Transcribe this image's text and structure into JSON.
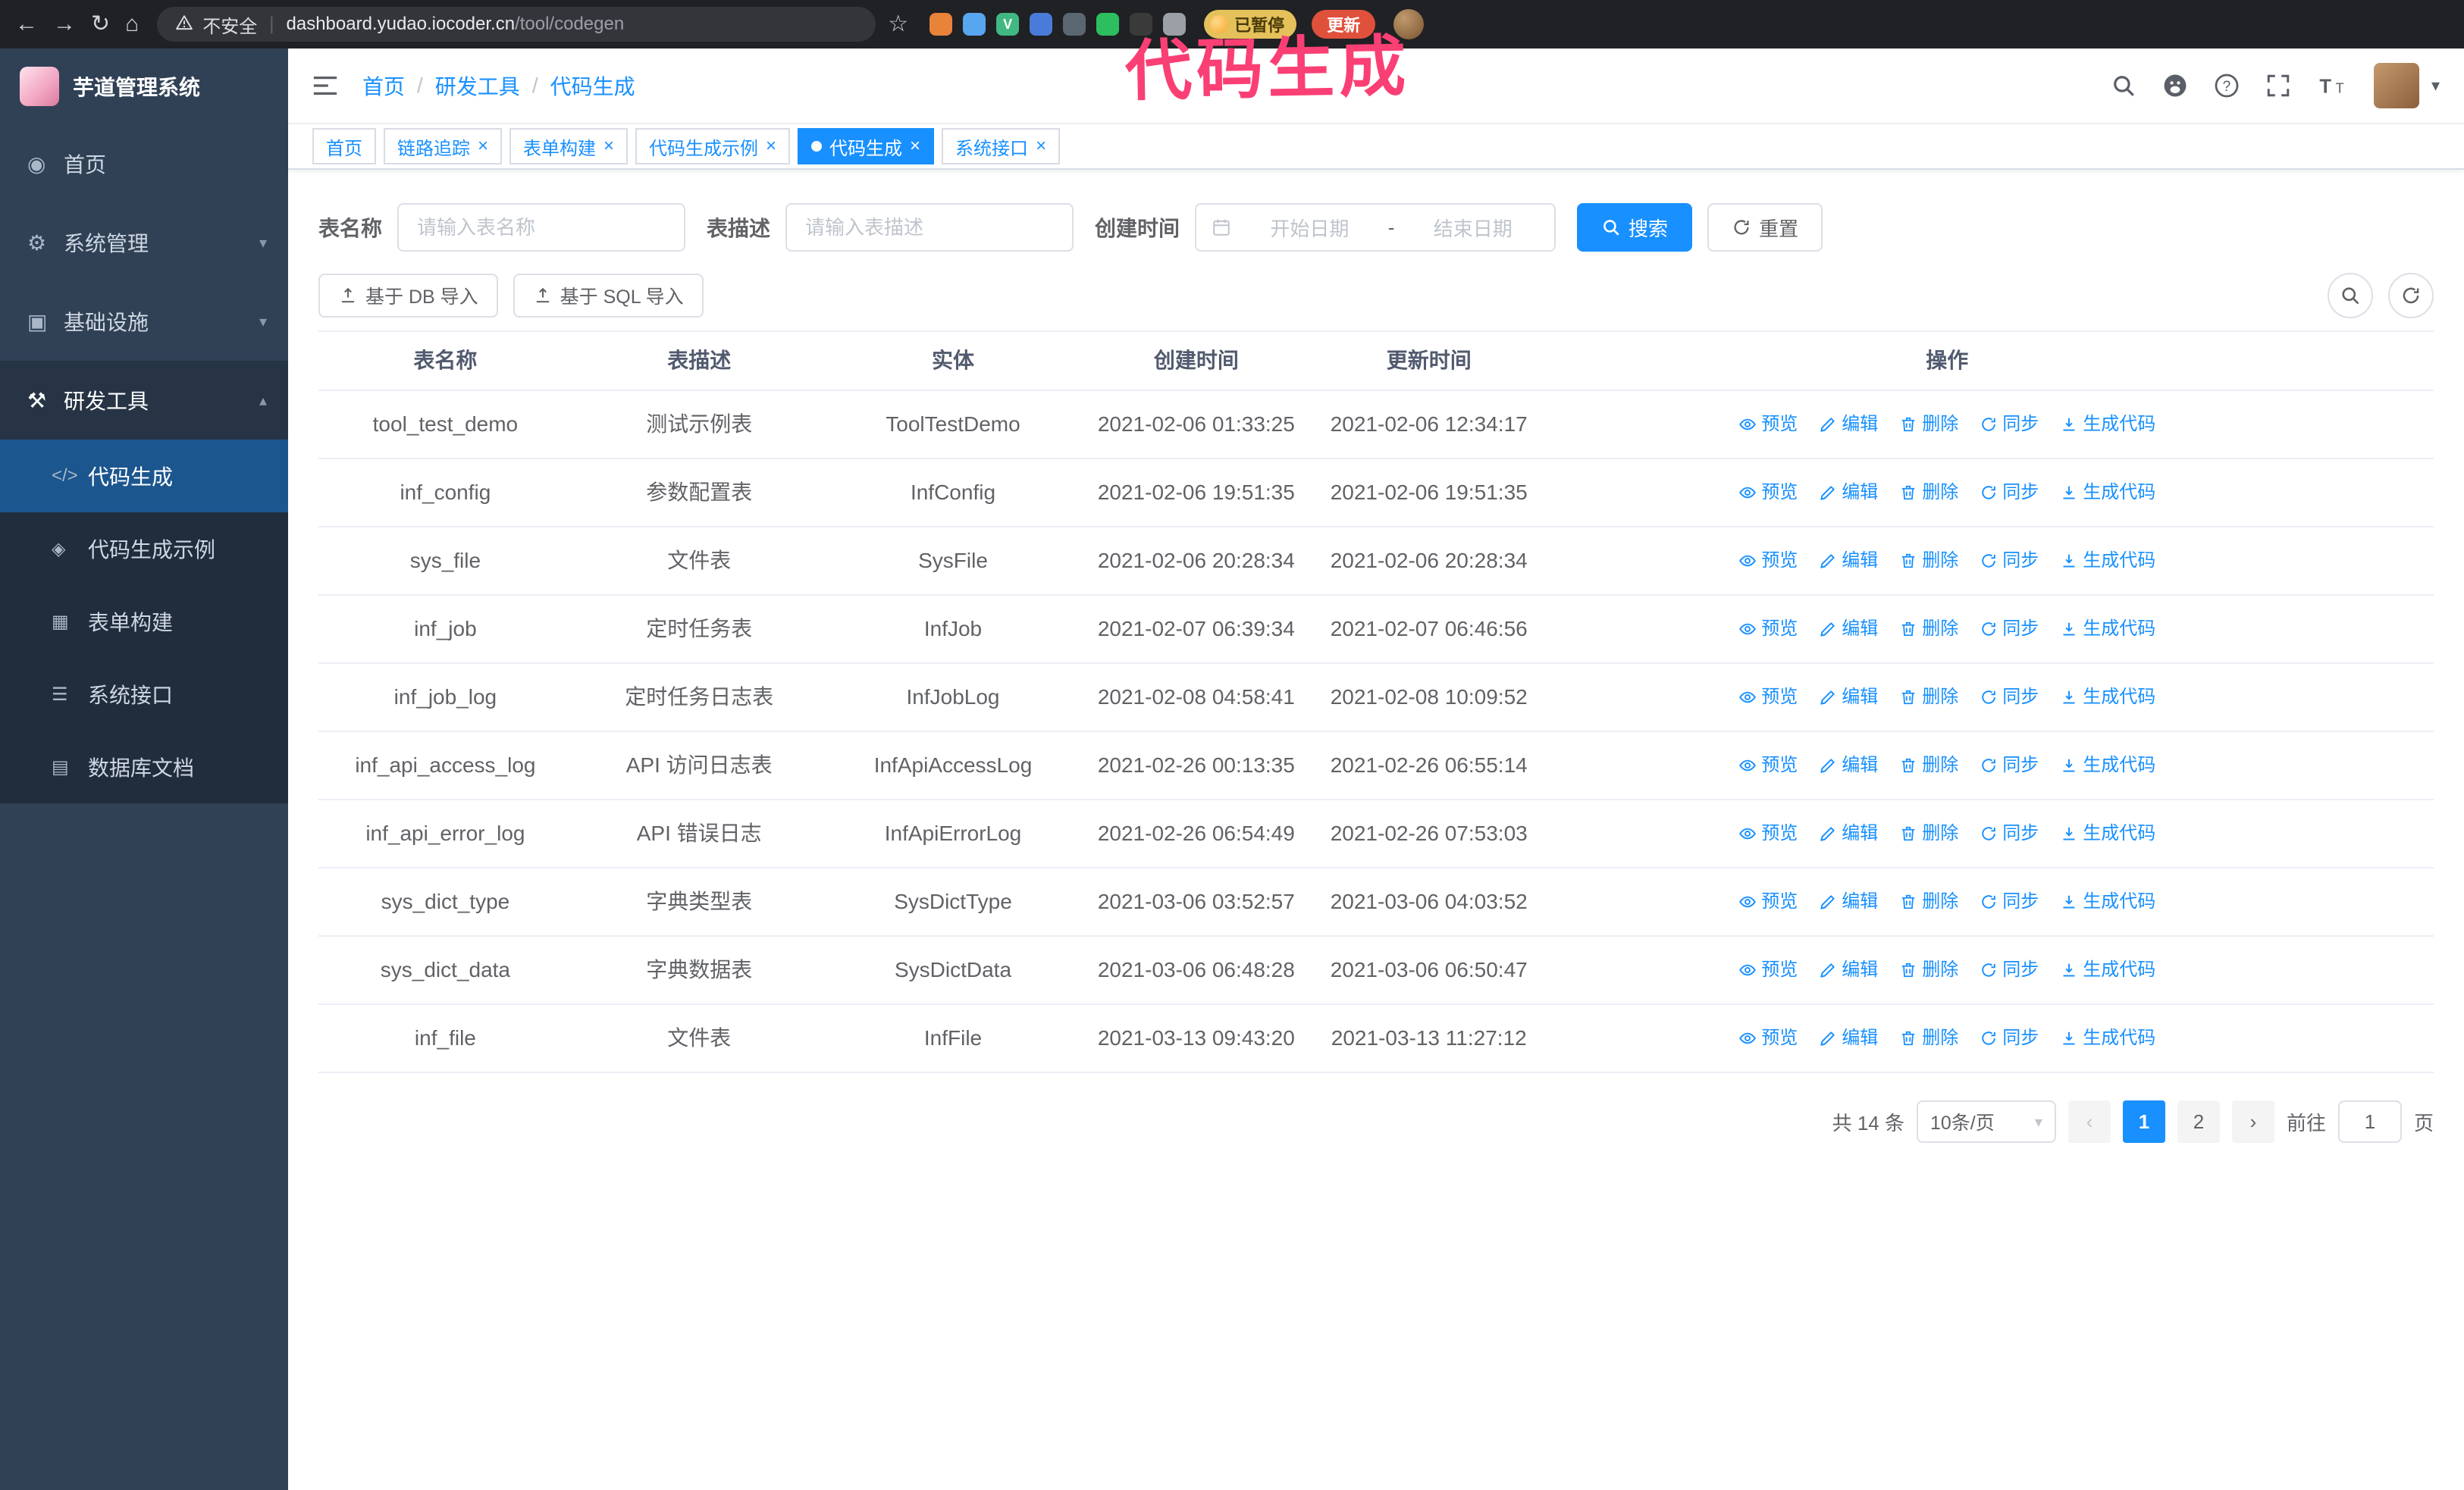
{
  "annotation": {
    "text": "代码生成",
    "color": "#fa3f74"
  },
  "browser": {
    "security_label": "不安全",
    "url_domain": "dashboard.yudao.iocoder.cn",
    "url_path": "/tool/codegen",
    "paused_badge": "已暂停",
    "update_button": "更新",
    "extensions": [
      {
        "name": "beer-extension-icon",
        "color": "#e8833a"
      },
      {
        "name": "water-drop-extension-icon",
        "color": "#58a6f0"
      },
      {
        "name": "vue-devtools-extension-icon",
        "color": "#41b883",
        "glyph": "V"
      },
      {
        "name": "accounts-extension-icon",
        "color": "#4a7bd8"
      },
      {
        "name": "screenshot-extension-icon",
        "color": "#5b6770"
      },
      {
        "name": "notes-extension-icon",
        "color": "#2dbe60"
      },
      {
        "name": "paw-extension-icon",
        "color": "#3a3a3a"
      },
      {
        "name": "extensions-puzzle-icon",
        "color": "#9aa0a6"
      }
    ]
  },
  "sidebar": {
    "logo_title": "芋道管理系统",
    "items": [
      {
        "id": "home",
        "label": "首页",
        "icon": "home-icon",
        "glyph": "◉",
        "chevron": ""
      },
      {
        "id": "system-management",
        "label": "系统管理",
        "icon": "gear-icon",
        "glyph": "⚙",
        "chevron": "▾"
      },
      {
        "id": "infrastructure",
        "label": "基础设施",
        "icon": "infrastructure-icon",
        "glyph": "▣",
        "chevron": "▾"
      },
      {
        "id": "dev-tools",
        "label": "研发工具",
        "icon": "tools-icon",
        "glyph": "⚒",
        "chevron": "▴",
        "active": true
      }
    ],
    "subitems": [
      {
        "id": "code-generation",
        "label": "代码生成",
        "icon": "code-icon",
        "glyph": "</>",
        "active": true
      },
      {
        "id": "codegen-example",
        "label": "代码生成示例",
        "icon": "example-icon",
        "glyph": "◈"
      },
      {
        "id": "form-builder",
        "label": "表单构建",
        "icon": "form-icon",
        "glyph": "▦"
      },
      {
        "id": "system-api",
        "label": "系统接口",
        "icon": "api-icon",
        "glyph": "☰"
      },
      {
        "id": "database-doc",
        "label": "数据库文档",
        "icon": "database-doc-icon",
        "glyph": "▤"
      }
    ]
  },
  "header": {
    "breadcrumb": [
      "首页",
      "研发工具",
      "代码生成"
    ],
    "breadcrumb_separator": "/"
  },
  "tabs": [
    {
      "id": "home",
      "label": "首页",
      "closable": false,
      "active": false
    },
    {
      "id": "trace",
      "label": "链路追踪",
      "closable": true,
      "active": false
    },
    {
      "id": "form-builder",
      "label": "表单构建",
      "closable": true,
      "active": false
    },
    {
      "id": "codegen-example",
      "label": "代码生成示例",
      "closable": true,
      "active": false
    },
    {
      "id": "codegen",
      "label": "代码生成",
      "closable": true,
      "active": true
    },
    {
      "id": "system-api",
      "label": "系统接口",
      "closable": true,
      "active": false
    }
  ],
  "filters": {
    "table_name_label": "表名称",
    "table_name_placeholder": "请输入表名称",
    "table_desc_label": "表描述",
    "table_desc_placeholder": "请输入表描述",
    "create_time_label": "创建时间",
    "date_start_placeholder": "开始日期",
    "date_separator": "-",
    "date_end_placeholder": "结束日期",
    "search_button": "搜索",
    "reset_button": "重置"
  },
  "toolbar": {
    "import_db": "基于 DB 导入",
    "import_sql": "基于 SQL 导入"
  },
  "table": {
    "columns": [
      "表名称",
      "表描述",
      "实体",
      "创建时间",
      "更新时间",
      "操作"
    ],
    "actions": [
      "预览",
      "编辑",
      "删除",
      "同步",
      "生成代码"
    ],
    "rows": [
      {
        "name": "tool_test_demo",
        "desc": "测试示例表",
        "entity": "ToolTestDemo",
        "created": "2021-02-06 01:33:25",
        "updated": "2021-02-06 12:34:17"
      },
      {
        "name": "inf_config",
        "desc": "参数配置表",
        "entity": "InfConfig",
        "created": "2021-02-06 19:51:35",
        "updated": "2021-02-06 19:51:35"
      },
      {
        "name": "sys_file",
        "desc": "文件表",
        "entity": "SysFile",
        "created": "2021-02-06 20:28:34",
        "updated": "2021-02-06 20:28:34"
      },
      {
        "name": "inf_job",
        "desc": "定时任务表",
        "entity": "InfJob",
        "created": "2021-02-07 06:39:34",
        "updated": "2021-02-07 06:46:56"
      },
      {
        "name": "inf_job_log",
        "desc": "定时任务日志表",
        "entity": "InfJobLog",
        "created": "2021-02-08 04:58:41",
        "updated": "2021-02-08 10:09:52"
      },
      {
        "name": "inf_api_access_log",
        "desc": "API 访问日志表",
        "entity": "InfApiAccessLog",
        "created": "2021-02-26 00:13:35",
        "updated": "2021-02-26 06:55:14"
      },
      {
        "name": "inf_api_error_log",
        "desc": "API 错误日志",
        "entity": "InfApiErrorLog",
        "created": "2021-02-26 06:54:49",
        "updated": "2021-02-26 07:53:03"
      },
      {
        "name": "sys_dict_type",
        "desc": "字典类型表",
        "entity": "SysDictType",
        "created": "2021-03-06 03:52:57",
        "updated": "2021-03-06 04:03:52"
      },
      {
        "name": "sys_dict_data",
        "desc": "字典数据表",
        "entity": "SysDictData",
        "created": "2021-03-06 06:48:28",
        "updated": "2021-03-06 06:50:47"
      },
      {
        "name": "inf_file",
        "desc": "文件表",
        "entity": "InfFile",
        "created": "2021-03-13 09:43:20",
        "updated": "2021-03-13 11:27:12"
      }
    ]
  },
  "pagination": {
    "total": "共 14 条",
    "page_size": "10条/页",
    "pages": [
      "1",
      "2"
    ],
    "goto_prefix": "前往",
    "goto_value": "1",
    "goto_suffix": "页"
  }
}
